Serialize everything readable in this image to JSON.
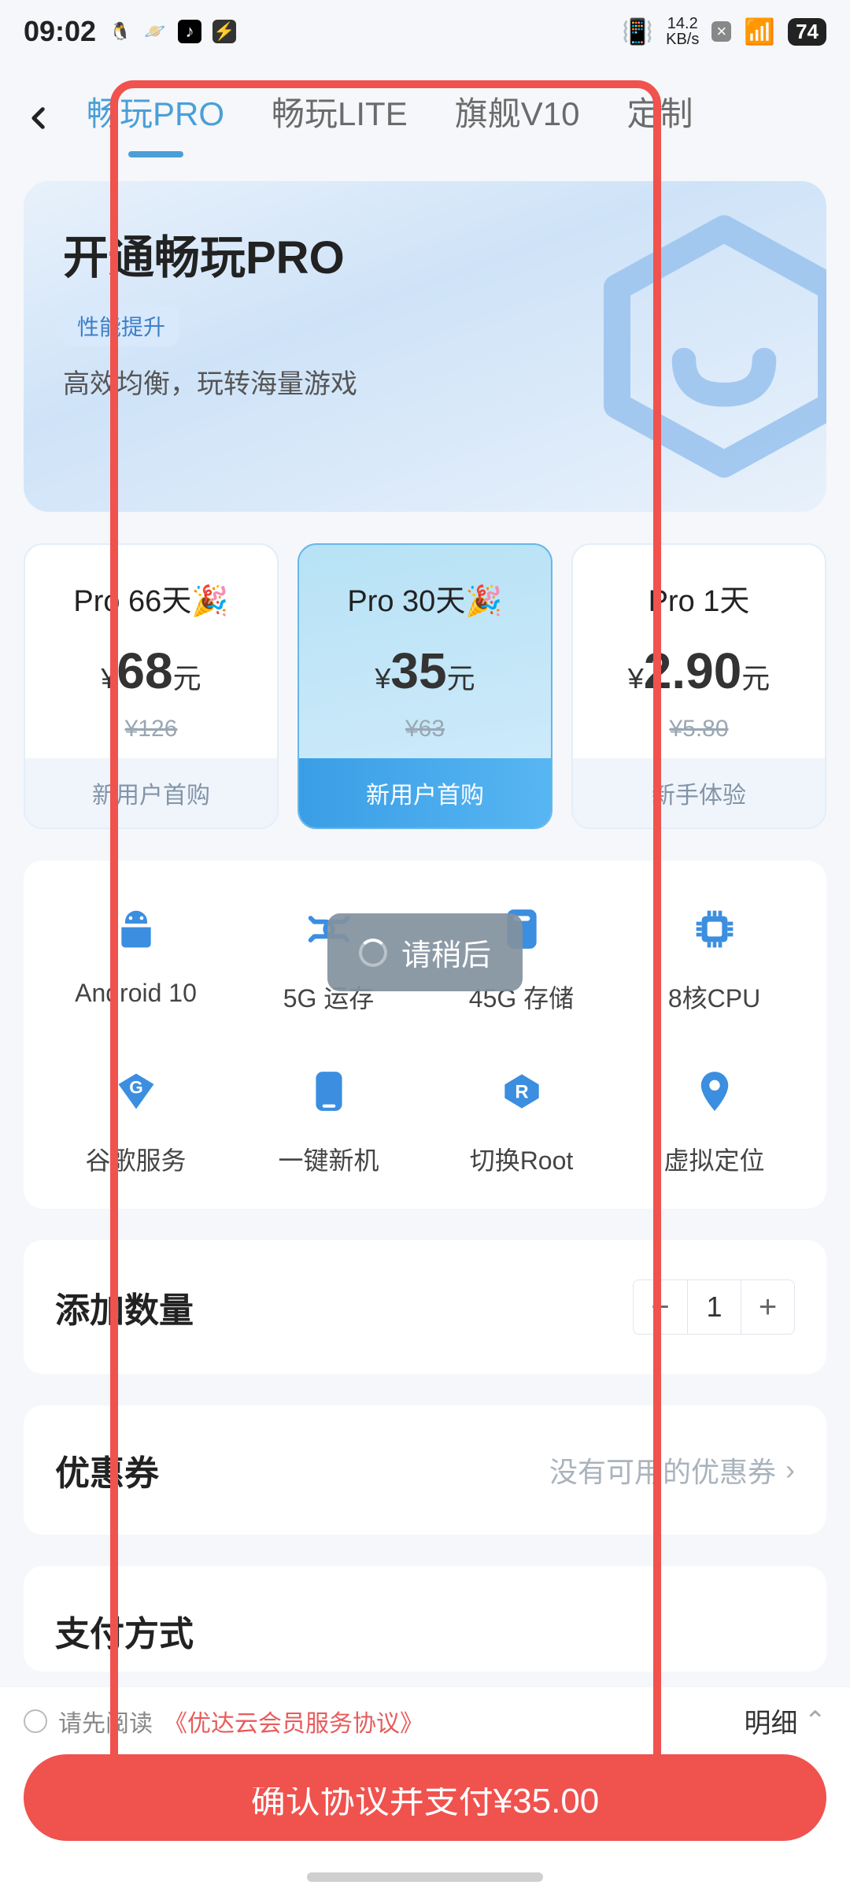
{
  "status": {
    "time": "09:02",
    "net_speed_top": "14.2",
    "net_speed_bot": "KB/s",
    "battery": "74"
  },
  "tabs": [
    {
      "label": "畅玩PRO",
      "active": true
    },
    {
      "label": "畅玩LITE",
      "active": false
    },
    {
      "label": "旗舰V10",
      "active": false
    },
    {
      "label": "定制",
      "active": false
    }
  ],
  "hero": {
    "title": "开通畅玩PRO",
    "pill": "性能提升",
    "subtitle": "高效均衡，玩转海量游戏"
  },
  "plans": [
    {
      "name": "Pro 66天🎉",
      "currency": "¥",
      "price": "68",
      "unit": "元",
      "original": "¥126",
      "footer": "新用户首购",
      "selected": false
    },
    {
      "name": "Pro 30天🎉",
      "currency": "¥",
      "price": "35",
      "unit": "元",
      "original": "¥63",
      "footer": "新用户首购",
      "selected": true
    },
    {
      "name": "Pro 1天",
      "currency": "¥",
      "price": "2.90",
      "unit": "元",
      "original": "¥5.80",
      "footer": "新手体验",
      "selected": false
    }
  ],
  "features": [
    {
      "icon": "android-icon",
      "label": "Android 10"
    },
    {
      "icon": "ram-icon",
      "label": "5G 运存"
    },
    {
      "icon": "storage-icon",
      "label": "45G 存储"
    },
    {
      "icon": "cpu-icon",
      "label": "8核CPU"
    },
    {
      "icon": "google-icon",
      "label": "谷歌服务"
    },
    {
      "icon": "phone-icon",
      "label": "一键新机"
    },
    {
      "icon": "root-icon",
      "label": "切换Root"
    },
    {
      "icon": "location-icon",
      "label": "虚拟定位"
    }
  ],
  "quantity": {
    "title": "添加数量",
    "value": "1"
  },
  "coupon": {
    "title": "优惠券",
    "value": "没有可用的优惠券"
  },
  "payment": {
    "title": "支付方式"
  },
  "agreement": {
    "prefix": "请先阅读",
    "link": "《优达云会员服务协议》",
    "detail": "明细"
  },
  "pay_button": "确认协议并支付¥35.00",
  "toast": "请稍后"
}
